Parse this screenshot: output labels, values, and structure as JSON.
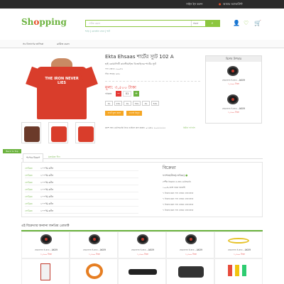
{
  "topbar": {
    "signin": "সাইন ইন করুন",
    "account": "আমার অ্যাকাউন্ট"
  },
  "header": {
    "logo_a": "Sh",
    "logo_b": "o",
    "logo_c": "pping",
    "search_placeholder": "খোঁজ করুন",
    "category_label": "সকল",
    "suggestions": [
      "শাড়ি",
      "মোবাইল ফোন",
      "শার্ট"
    ],
    "icons": [
      "user-icon",
      "heart-icon",
      "cart-icon"
    ]
  },
  "nav": {
    "categories": "সব বিভাগের তালিকা",
    "browse": "ব্রাউজ করুন"
  },
  "product": {
    "title": "Ekta Ehsaas শার্টের স্যুট 102 A",
    "subtitle": "হাই কোয়ালিটি কাস্টোমাইজ ডিজাইনের শার্টের স্যুট",
    "code": "পণ্য কোড: ৫০০৪২",
    "stock": "স্টক আছে: ৬৪৫",
    "price": "মূল্য: ৩,৫০০ টাকা",
    "qty_label": "পরিমাণ",
    "qty": "01",
    "sizes": [
      "XL",
      "2XL",
      "XL",
      "3XL",
      "XL",
      "5XL"
    ],
    "buttons": [
      "কার্টে যুক্ত করুন",
      "এখনই কিনুন"
    ],
    "note": "ক্যাশ অন ডেলিভারি নিতে চাইলে কল করুন: ০১৬৪৫ ৫০৫৫৫৫৫৫",
    "note2": "রিটার্ন পলিসি",
    "shirt_text": "THE IRON NEVER LIES"
  },
  "similar": {
    "header": "বিশেষ উপহার",
    "items": [
      {
        "name": "হেডফোন ই-বাড - AK09",
        "price": "১,৫০০ টাকা"
      },
      {
        "name": "হেডফোন ই-বাড - AK09",
        "price": "১,৫০০ টাকা"
      }
    ]
  },
  "back_to_top": "Back to Top",
  "tabs": [
    "পণ্যের বিবরণ",
    "মতামত দিন"
  ],
  "specs": [
    {
      "k": "ফেব্রিক:",
      "v": "১০০% কটন"
    },
    {
      "k": "ফেব্রিক:",
      "v": "১০০% কটন"
    },
    {
      "k": "ফেব্রিক:",
      "v": "১০০% কটন"
    },
    {
      "k": "ফেব্রিক:",
      "v": "১০০% কটন"
    },
    {
      "k": "ফেব্রিক:",
      "v": "১০০% কটন"
    },
    {
      "k": "ফেব্রিক:",
      "v": "১০০% কটন"
    },
    {
      "k": "ফেব্রিক:",
      "v": "১০০% কটন"
    }
  ],
  "seller": {
    "heading": "বিক্রেতা",
    "name": "ফ্যাশনহাউজ(ফেব্রিক)",
    "points": [
      "দেশীয় বিক্রেতা ও দ্রুত ডেলিভারি",
      "১০০% ক্যাশ ব্যাক গ্যারান্টি",
      "৭ দিনের মধ্যে পণ্য ফেরত দেয়া যাবে",
      "৭ দিনের মধ্যে পণ্য ফেরত দেয়া যাবে",
      "৭ দিনের মধ্যে পণ্য ফেরত দেয়া যাবে",
      "৭ দিনের মধ্যে পণ্য ফেরত দেয়া যাবে"
    ]
  },
  "related": {
    "heading": "এই বিক্রেতার অন্যান্য জনপ্রিয় প্রোডাক্ট",
    "items": [
      {
        "name": "হেডফোন ই-বাড - AK09",
        "price": "১,৫০০ টাকা"
      },
      {
        "name": "হেডফোন ই-বাড - AK09",
        "price": "১,৫০০ টাকা"
      },
      {
        "name": "হেডফোন ই-বাড - AK09",
        "price": "১,৫০০ টাকা"
      },
      {
        "name": "হেডফোন ই-বাড - AK09",
        "price": "১,৫০০ টাকা"
      },
      {
        "name": "হেডফোন ই-বাড - AK09",
        "price": "১,৫০০ টাকা"
      }
    ]
  },
  "colors": {
    "accent": "#6cb33f",
    "price": "#e53935",
    "shirt": "#d93d2b"
  }
}
